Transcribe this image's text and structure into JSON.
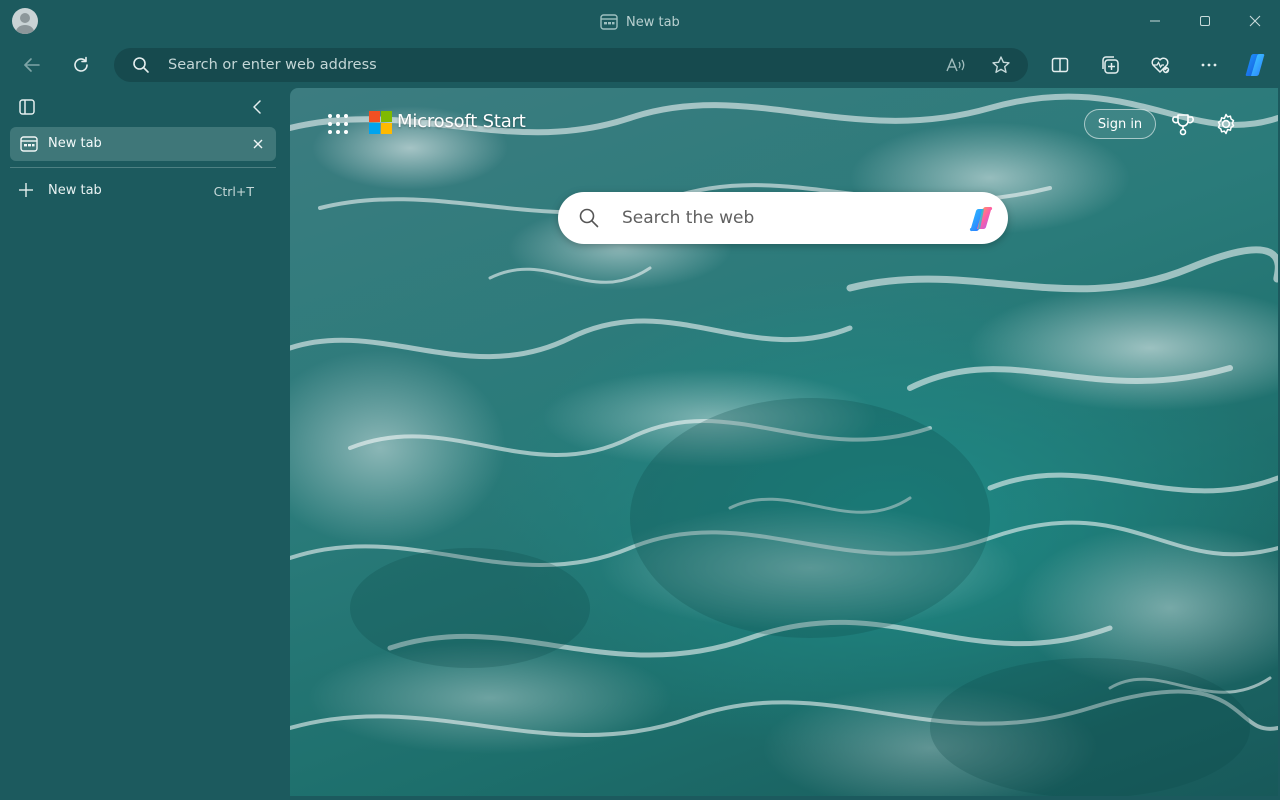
{
  "window": {
    "title": "New tab"
  },
  "icons": {
    "profile": "profile-avatar",
    "back": "back-arrow-icon",
    "refresh": "refresh-icon",
    "search": "search-icon",
    "read_aloud": "read-aloud-icon",
    "favorite": "star-icon",
    "split_screen": "split-screen-icon",
    "collections": "collections-icon",
    "browser_essentials": "heart-pulse-icon",
    "more": "more-icon",
    "copilot": "copilot-icon"
  },
  "address_bar": {
    "placeholder": "Search or enter web address"
  },
  "sidebar": {
    "tabs": [
      {
        "title": "New tab",
        "active": true
      }
    ],
    "new_tab": {
      "label": "New tab",
      "shortcut": "Ctrl+T"
    }
  },
  "new_tab_page": {
    "brand": "Microsoft Start",
    "sign_in_label": "Sign in",
    "search_placeholder": "Search the web"
  },
  "colors": {
    "chrome_bg": "#1c5a5e",
    "address_bg": "#164a4e",
    "active_tab_bg": "#3f7779",
    "ms_red": "#f25022",
    "ms_green": "#7fba00",
    "ms_blue": "#00a4ef",
    "ms_yellow": "#ffb900"
  }
}
